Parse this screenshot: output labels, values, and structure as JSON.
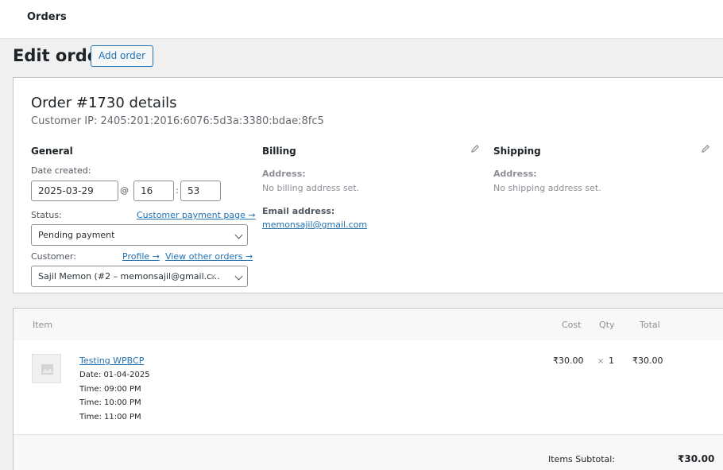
{
  "topbar": {
    "title": "Orders"
  },
  "header": {
    "title": "Edit order",
    "add_order_label": "Add order"
  },
  "order": {
    "title": "Order #1730 details",
    "customer_ip": "Customer IP: 2405:201:2016:6076:5d3a:3380:bdae:8fc5"
  },
  "general": {
    "heading": "General",
    "date_created_label": "Date created:",
    "date_value": "2025-03-29",
    "at_symbol": "@",
    "hour": "16",
    "colon": ":",
    "minute": "53",
    "status_label": "Status:",
    "customer_payment_link": "Customer payment page →",
    "status_value": "Pending payment",
    "customer_label": "Customer:",
    "profile_link": "Profile →",
    "view_orders_link": "View other orders →",
    "customer_value": "Sajil Memon (#2 – memonsajil@gmail.c...",
    "clear_symbol": "×"
  },
  "billing": {
    "heading": "Billing",
    "address_label": "Address:",
    "address_value": "No billing address set.",
    "email_label": "Email address:",
    "email_value": "memonsajil@gmail.com"
  },
  "shipping": {
    "heading": "Shipping",
    "address_label": "Address:",
    "address_value": "No shipping address set."
  },
  "items": {
    "headers": {
      "item": "Item",
      "cost": "Cost",
      "qty": "Qty",
      "total": "Total"
    },
    "rows": [
      {
        "name": "Testing WPBCP",
        "meta": [
          "Date: 01-04-2025",
          "Time: 09:00 PM",
          "Time: 10:00 PM",
          "Time: 11:00 PM"
        ],
        "cost": "₹30.00",
        "times": "×",
        "qty": "1",
        "total": "₹30.00"
      }
    ],
    "subtotal_label": "Items Subtotal:",
    "subtotal_value": "₹30.00"
  },
  "colors": {
    "link": "#2271b1",
    "border": "#c3c4c7",
    "background": "#f0f0f1"
  }
}
